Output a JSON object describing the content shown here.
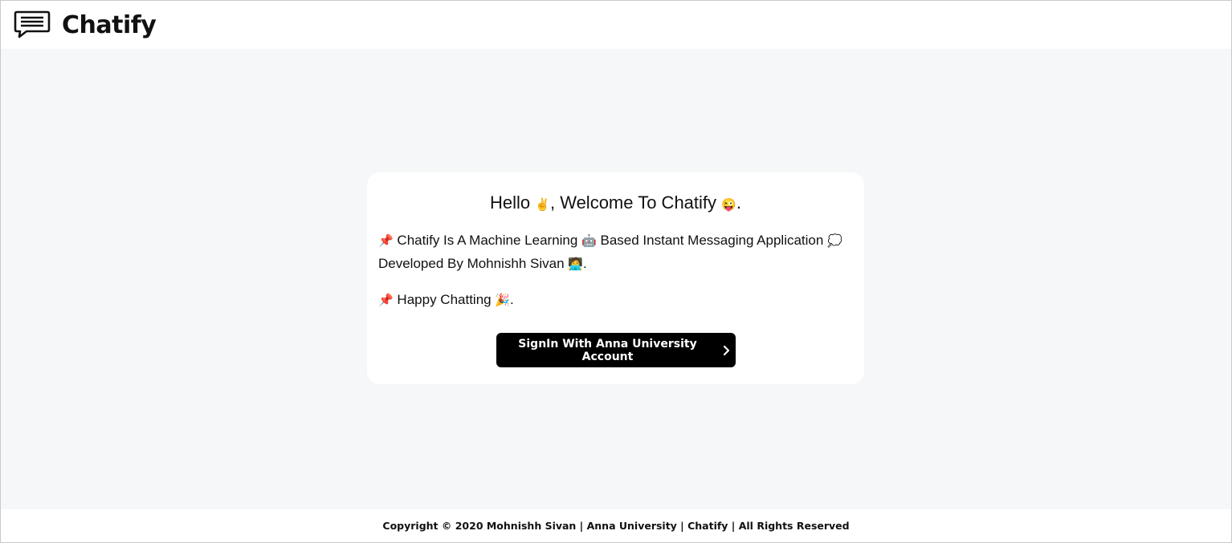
{
  "navbar": {
    "brand_name": "Chatify",
    "brand_icon": "chat-bubble-icon"
  },
  "card": {
    "greeting": {
      "hello": "Hello",
      "wave_emoji": "✌️",
      "welcome": ", Welcome To Chatify",
      "face_emoji": "😜",
      "end": "."
    },
    "line1": {
      "pin_emoji": "📌",
      "text_a": "Chatify Is A Machine Learning",
      "robot_emoji": "🤖",
      "text_b": "Based Instant Messaging Application",
      "bubble_emoji": "💭",
      "text_c": "Developed By Mohnishh Sivan",
      "dev_emoji": "🧑‍💻",
      "end": "."
    },
    "line2": {
      "pin_emoji": "📌",
      "text": "Happy Chatting",
      "party_emoji": "🎉",
      "end": "."
    },
    "signin_button": {
      "label": "SignIn With Anna University Account",
      "icon": "chevron-right-icon"
    }
  },
  "footer": {
    "text": "Copyright © 2020 Mohnishh Sivan | Anna University | Chatify | All Rights Reserved"
  },
  "colors": {
    "background": "#f6f7f9",
    "card": "#ffffff",
    "button": "#000000",
    "text": "#111111"
  }
}
